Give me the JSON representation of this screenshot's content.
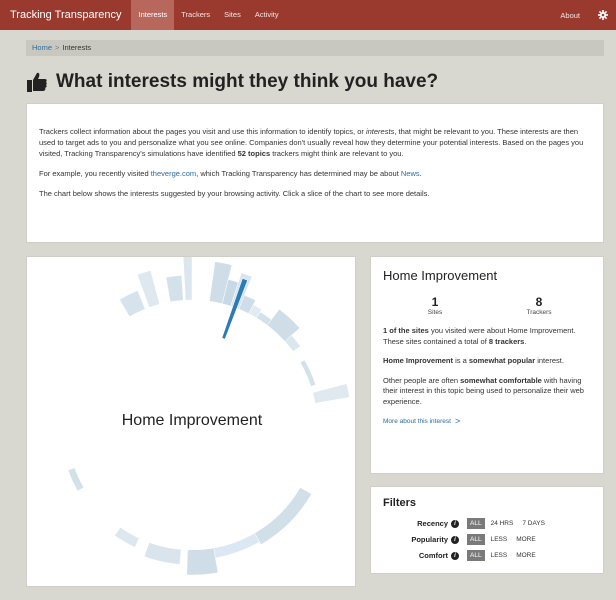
{
  "nav": {
    "brand": "Tracking Transparency",
    "items": [
      {
        "label": "Interests",
        "active": true
      },
      {
        "label": "Trackers",
        "active": false
      },
      {
        "label": "Sites",
        "active": false
      },
      {
        "label": "Activity",
        "active": false
      }
    ],
    "about": "About",
    "settings_icon": "gear-icon",
    "bar_color": "#9a3a2f"
  },
  "breadcrumb": {
    "home": "Home",
    "separator": ">",
    "current": "Interests"
  },
  "page_title": "What interests might they think you have?",
  "title_icon": "thumbs-up-icon",
  "intro": {
    "p1_a": "Trackers collect information about the pages you visit and use this information to identify topics, or ",
    "p1_em": "interests",
    "p1_b": ", that might be relevant to you. These interests are then used to target ads to you and personalize what you see online. Companies don't usually reveal how they determine your potential interests. Based on the pages you visited, Tracking Transparency's simulations have identified ",
    "p1_strong": "52 topics",
    "p1_c": " trackers might think are relevant to you.",
    "p2_a": "For example, you recently visited ",
    "p2_link": "theverge.com",
    "p2_b": ", which Tracking Transparency has determined may be about ",
    "p2_topic": "News",
    "p2_c": ".",
    "p3": "The chart below shows the interests suggested by your browsing activity. Click a slice of the chart to see more details."
  },
  "chart": {
    "center_label": "Home Improvement",
    "highlight_color": "#2b7bb9",
    "base_color": "#cfdde8"
  },
  "detail": {
    "title": "Home Improvement",
    "sites_value": "1",
    "sites_label": "Sites",
    "trackers_value": "8",
    "trackers_label": "Trackers",
    "p1_strong": "1 of the sites",
    "p1_a": " you visited were about Home Improvement. These sites contained a total of ",
    "p1_strong2": "8 trackers",
    "p1_b": ".",
    "p2_strong": "Home Improvement",
    "p2_a": " is a ",
    "p2_strong2": "somewhat popular",
    "p2_b": " interest.",
    "p3_a": "Other people are often ",
    "p3_strong": "somewhat comfortable",
    "p3_b": " with having their interest in this topic being used to personalize their web experience.",
    "more_link": "More about this interest",
    "chevron": ">"
  },
  "filters": {
    "title": "Filters",
    "rows": [
      {
        "label": "Recency",
        "options": [
          "ALL",
          "24 HRS",
          "7 DAYS"
        ]
      },
      {
        "label": "Popularity",
        "options": [
          "ALL",
          "LESS",
          "MORE"
        ]
      },
      {
        "label": "Comfort",
        "options": [
          "ALL",
          "LESS",
          "MORE"
        ]
      }
    ],
    "info_icon": "info-icon"
  }
}
